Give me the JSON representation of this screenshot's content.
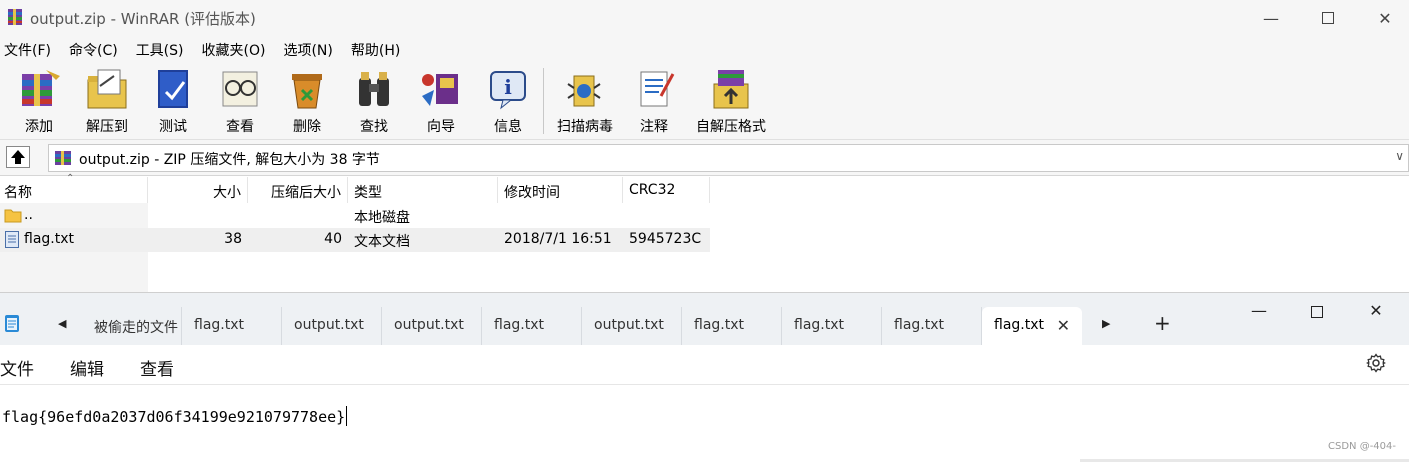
{
  "winrar": {
    "title": "output.zip - WinRAR (评估版本)",
    "menu": [
      "文件(F)",
      "命令(C)",
      "工具(S)",
      "收藏夹(O)",
      "选项(N)",
      "帮助(H)"
    ],
    "toolbar": {
      "add": "添加",
      "extract": "解压到",
      "test": "测试",
      "view": "查看",
      "delete": "删除",
      "find": "查找",
      "wizard": "向导",
      "info": "信息",
      "scan": "扫描病毒",
      "comment": "注释",
      "sfx": "自解压格式"
    },
    "address": "output.zip - ZIP 压缩文件, 解包大小为 38 字节",
    "columns": {
      "name": "名称",
      "size": "大小",
      "packed": "压缩后大小",
      "type": "类型",
      "modified": "修改时间",
      "crc": "CRC32"
    },
    "rows": [
      {
        "name": "..",
        "size": "",
        "packed": "",
        "type": "本地磁盘",
        "modified": "",
        "crc": ""
      },
      {
        "name": "flag.txt",
        "size": "38",
        "packed": "40",
        "type": "文本文档",
        "modified": "2018/7/1 16:51",
        "crc": "5945723C"
      }
    ],
    "colors": {
      "chrome": "#f6f6f6",
      "selected_row": "#efefef"
    }
  },
  "notepad": {
    "tabs": [
      "被偷走的文件",
      "flag.txt",
      "output.txt",
      "output.txt",
      "flag.txt",
      "output.txt",
      "flag.txt",
      "flag.txt",
      "flag.txt",
      "flag.txt"
    ],
    "active_tab_index": 9,
    "menu": [
      "文件",
      "编辑",
      "查看"
    ],
    "content": "flag{96efd0a2037d06f34199e921079778ee}",
    "watermark": "CSDN @-404-",
    "colors": {
      "tabbar": "#eef1f4"
    }
  }
}
